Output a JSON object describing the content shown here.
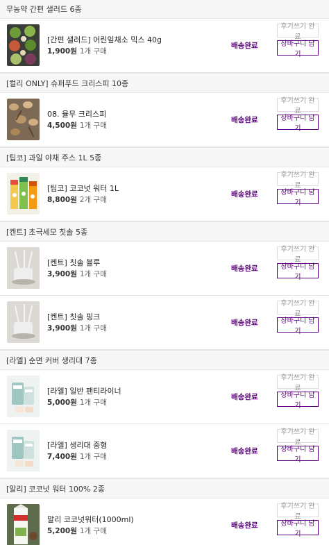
{
  "groups": [
    {
      "title": "무농약 간편 샐러드 6종",
      "items": [
        {
          "name": "[간편 샐러드] 어린잎채소 믹스 40g",
          "price": "1,900원",
          "qty": "1개 구매",
          "status": "배송완료",
          "review_label": "후기쓰기 완료",
          "cart_label": "장바구니 담기",
          "thumb_icon": "salad-bowls-thumbnail"
        }
      ]
    },
    {
      "title": "[컬리 ONLY] 슈퍼푸드 크리스피 10종",
      "items": [
        {
          "name": "08. 율무 크리스피",
          "price": "4,500원",
          "qty": "1개 구매",
          "status": "배송완료",
          "review_label": "후기쓰기 완료",
          "cart_label": "장바구니 담기",
          "thumb_icon": "grain-spoons-thumbnail"
        }
      ]
    },
    {
      "title": "[팁코] 과일 야채 주스 1L 5종",
      "items": [
        {
          "name": "[팁코] 코코넛 워터 1L",
          "price": "8,800원",
          "qty": "2개 구매",
          "status": "배송완료",
          "review_label": "후기쓰기 완료",
          "cart_label": "장바구니 담기",
          "thumb_icon": "juice-cartons-thumbnail"
        }
      ]
    },
    {
      "title": "[켄트] 초극세모 칫솔 5종",
      "items": [
        {
          "name": "[켄트] 칫솔 블루",
          "price": "3,900원",
          "qty": "1개 구매",
          "status": "배송완료",
          "review_label": "후기쓰기 완료",
          "cart_label": "장바구니 담기",
          "thumb_icon": "toothbrush-cup-thumbnail"
        },
        {
          "name": "[켄트] 칫솔 핑크",
          "price": "3,900원",
          "qty": "1개 구매",
          "status": "배송완료",
          "review_label": "후기쓰기 완료",
          "cart_label": "장바구니 담기",
          "thumb_icon": "toothbrush-cup-thumbnail"
        }
      ]
    },
    {
      "title": "[라엘] 순면 커버 생리대 7종",
      "items": [
        {
          "name": "[라엘] 일반 팬티라이너",
          "price": "5,000원",
          "qty": "1개 구매",
          "status": "배송완료",
          "review_label": "후기쓰기 완료",
          "cart_label": "장바구니 담기",
          "thumb_icon": "pad-package-thumbnail"
        },
        {
          "name": "[라엘] 생리대 중형",
          "price": "7,400원",
          "qty": "1개 구매",
          "status": "배송완료",
          "review_label": "후기쓰기 완료",
          "cart_label": "장바구니 담기",
          "thumb_icon": "pad-package-thumbnail"
        }
      ]
    },
    {
      "title": "[말리] 코코넛 워터 100% 2종",
      "items": [
        {
          "name": "말리 코코넛워터(1000ml)",
          "price": "5,200원",
          "qty": "1개 구매",
          "status": "배송완료",
          "review_label": "후기쓰기 완료",
          "cart_label": "장바구니 담기",
          "thumb_icon": "coconut-carton-thumbnail"
        }
      ]
    }
  ],
  "colors": {
    "accent": "#5f0080",
    "border": "#e5e5e5",
    "header_bg": "#f7f7f7"
  }
}
